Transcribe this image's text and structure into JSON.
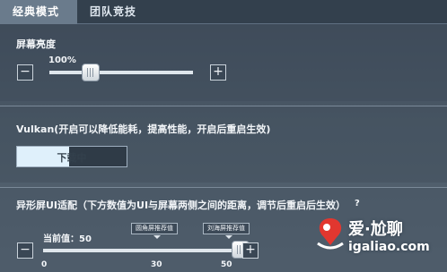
{
  "tabs": [
    {
      "label": "经典模式",
      "active": true
    },
    {
      "label": "团队竞技",
      "active": false
    }
  ],
  "brightness": {
    "title": "屏幕亮度",
    "value_label": "100%",
    "minus": "−",
    "plus": "+",
    "level_fraction": 0.25
  },
  "vulkan": {
    "title": "Vulkan(开启可以降低能耗，提高性能，开启后重启生效)",
    "state_label": "下载中"
  },
  "adapt": {
    "title": "异形屏UI适配（下方数值为UI与屏幕两侧之间的距离，调节后重启后生效）",
    "help_icon": "?",
    "current_label": "当前值：50",
    "minus": "−",
    "plus": "+",
    "ticks": [
      "0",
      "30",
      "50"
    ],
    "marker_a": "圆角屏推荐值",
    "marker_b": "刘海屏推荐值",
    "value": 50,
    "max": 50
  },
  "watermark": {
    "title": "爱·尬聊",
    "url": "igaliao.com"
  },
  "colors": {
    "accent": "#dff0fb",
    "logo_red": "#e2372f"
  }
}
